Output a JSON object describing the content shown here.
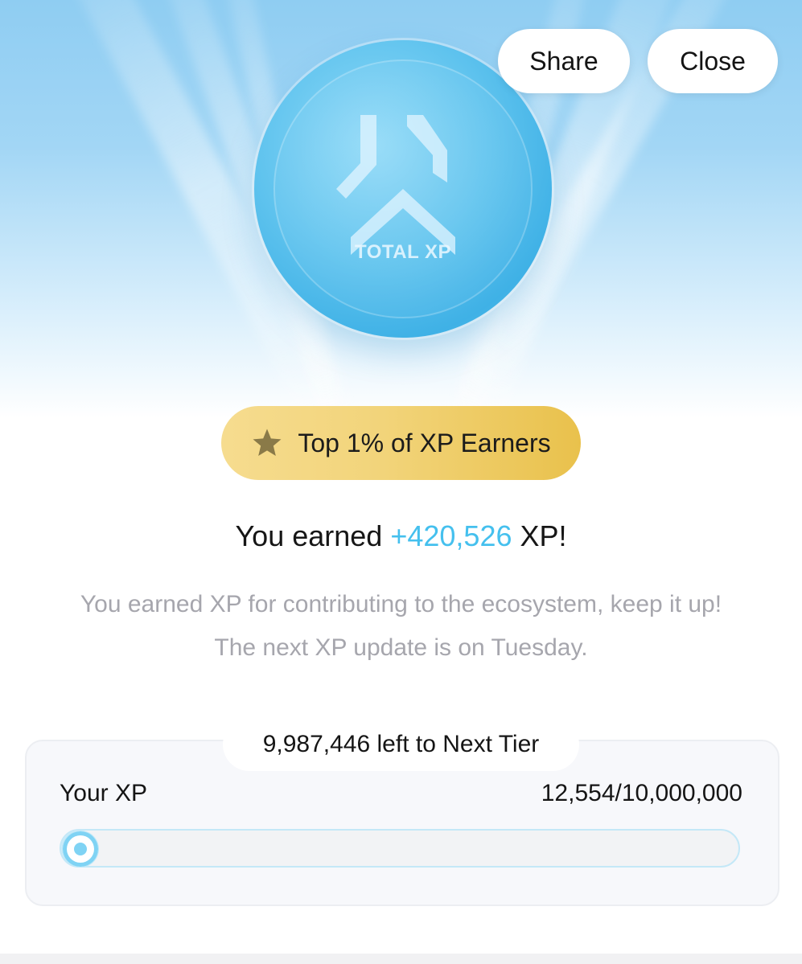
{
  "header": {
    "share_label": "Share",
    "close_label": "Close"
  },
  "coin": {
    "label": "TOTAL XP",
    "icon": "xp-logo-icon"
  },
  "rank": {
    "icon": "star-icon",
    "text": "Top 1% of XP Earners"
  },
  "earned": {
    "prefix": "You earned ",
    "amount": "+420,526",
    "suffix": " XP!"
  },
  "description": "You earned XP for contributing to the ecosystem, keep it up! The next XP update is on Tuesday.",
  "tier": {
    "remaining_text": "9,987,446 left to Next Tier",
    "your_xp_label": "Your XP",
    "progress_text": "12,554/10,000,000",
    "progress_fraction": 0.0012554
  },
  "colors": {
    "accent": "#45c0ee",
    "gold": "#f2d47a",
    "muted_text": "#a6a6ad"
  }
}
